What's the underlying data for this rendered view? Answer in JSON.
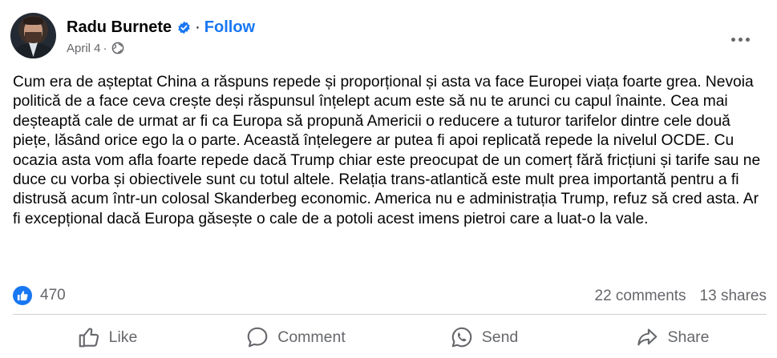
{
  "post": {
    "author": "Radu Burnete",
    "follow_label": "Follow",
    "date": "April 4",
    "text": "Cum era de așteptat China a răspuns repede și proporțional și asta va face Europei viața foarte grea. Nevoia politică de a face ceva crește deși răspunsul înțelept acum este să nu te arunci cu capul înainte. Cea mai deșteaptă cale de urmat ar fi ca Europa să propună Americii o reducere a tuturor tarifelor dintre cele două piețe, lăsând orice ego la o parte. Această înțelegere ar putea fi apoi replicată repede la nivelul OCDE. Cu ocazia asta vom afla foarte repede dacă Trump chiar este preocupat de un comerț fără fricțiuni și tarife sau ne duce cu vorba și obiectivele sunt cu totul altele. Relația trans-atlantică este mult prea importantă pentru a fi distrusă acum într-un colosal Skanderbeg economic. America nu e administrația Trump, refuz să cred asta. Ar fi excepțional dacă Europa găsește o cale de a potoli acest imens pietroi care a luat-o la vale."
  },
  "stats": {
    "reactions": "470",
    "comments": "22 comments",
    "shares": "13 shares"
  },
  "actions": {
    "like": "Like",
    "comment": "Comment",
    "send": "Send",
    "share": "Share"
  },
  "icons": {
    "verified": "verified-badge-icon",
    "audience": "globe-icon",
    "more": "more-options-icon",
    "reaction": "thumbs-up-icon"
  },
  "colors": {
    "accent": "#1877f2",
    "secondary_text": "#65676b",
    "primary_text": "#050505"
  }
}
